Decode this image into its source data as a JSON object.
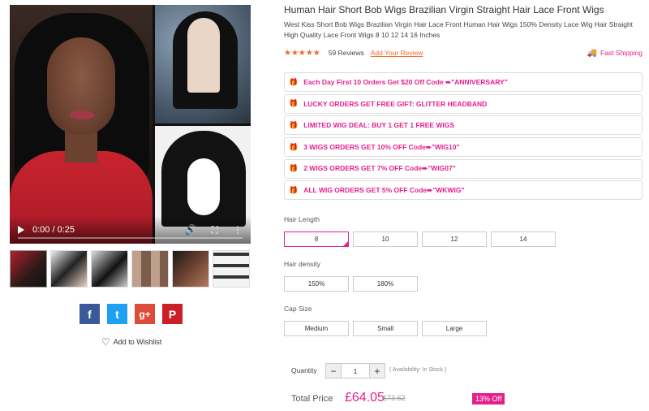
{
  "product": {
    "title": "Human Hair Short Bob Wigs Brazilian Virgin Straight Hair Lace Front Wigs",
    "subtitle": "West Kiss Short Bob Wigs Brazilian Virgin Hair Lace Front Human Hair Wigs 150% Density Lace Wig Hair Straight High Quality Lace Front Wigs 8 10 12 14 16 Inches",
    "rating_stars": "★★★★★",
    "rating_value": 5,
    "reviews_text": "59 Reviews",
    "add_review_label": "Add Your Review",
    "shipping_label": "Fast Shipping"
  },
  "video": {
    "time_text": "0:00 / 0:25",
    "progress": 0
  },
  "promos": [
    "Each Day First 10 Orders Get $20 Off Code ➨\"ANNIVERSARY\"",
    "LUCKY ORDERS GET FREE GIFT: GLITTER HEADBAND",
    "LIMITED WIG DEAL: BUY 1 GET 1 FREE WIGS",
    "3 WIGS ORDERS GET 10% OFF Code➨\"WIG10\"",
    "2 WIGS ORDERS GET 7% OFF Code➨\"WIG07\"",
    "ALL WIG ORDERS GET 5% OFF Code➨\"WKWIG\""
  ],
  "options": {
    "length": {
      "label": "Hair Length",
      "values": [
        "8",
        "10",
        "12",
        "14"
      ],
      "selected": "8"
    },
    "density": {
      "label": "Hair density",
      "values": [
        "150%",
        "180%"
      ]
    },
    "cap": {
      "label": "Cap Size",
      "values": [
        "Medium",
        "Small",
        "Large"
      ]
    }
  },
  "social": {
    "facebook": "f",
    "twitter": "t",
    "googleplus": "g+",
    "pinterest": "P"
  },
  "wishlist_label": "Add to Wishlist",
  "purchase": {
    "quantity_label": "Quantity",
    "quantity_minus": "−",
    "quantity_value": "1",
    "quantity_plus": "+",
    "availability": "( Availability: In Stock )",
    "total_label": "Total Price",
    "price": "£64.05",
    "old_price": "£73.62",
    "discount": "13% Off"
  },
  "colors": {
    "accent": "#e5208c",
    "star": "#f06b2a"
  }
}
